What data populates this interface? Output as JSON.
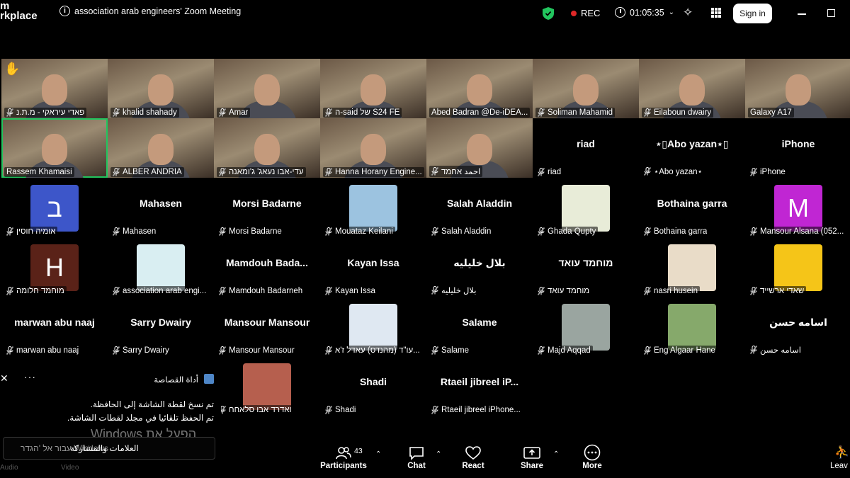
{
  "app": {
    "brand": "m\nrkplace",
    "meeting_title": "association arab engineers' Zoom Meeting",
    "rec_label": "REC",
    "timer": "01:05:35",
    "signin_label": "Sign in"
  },
  "colors": {
    "active_border": "#22c55e",
    "muted_mic": "#e02828",
    "rec_dot": "#e02828"
  },
  "tiles": [
    {
      "id": "t1",
      "name": "פאדי עיראקי - מ.ת.נ",
      "muted": true,
      "kind": "video",
      "hand": true
    },
    {
      "id": "t2",
      "name": "khalid shahady",
      "muted": true,
      "kind": "video"
    },
    {
      "id": "t3",
      "name": "Amar",
      "muted": true,
      "kind": "video"
    },
    {
      "id": "t4",
      "name": "ה-said של S24 FE",
      "muted": true,
      "kind": "video"
    },
    {
      "id": "t5",
      "name": "Abed Badran  @De-iDEA...",
      "muted": false,
      "kind": "video"
    },
    {
      "id": "t6",
      "name": "Soliman Mahamid",
      "muted": true,
      "kind": "video"
    },
    {
      "id": "t7",
      "name": "Eilaboun dwairy",
      "muted": true,
      "kind": "video"
    },
    {
      "id": "t8",
      "name": "Galaxy A17",
      "muted": false,
      "kind": "video"
    },
    {
      "id": "t9",
      "name": "Rassem Khamaisi",
      "muted": false,
      "kind": "video",
      "active": true
    },
    {
      "id": "t10",
      "name": "ALBER ANDRIA",
      "muted": true,
      "kind": "video"
    },
    {
      "id": "t11",
      "name": "עדי-אבו נעאג' ג'ומאנה",
      "muted": true,
      "kind": "video"
    },
    {
      "id": "t12",
      "name": "Hanna Horany Engine...",
      "muted": true,
      "kind": "video"
    },
    {
      "id": "t13",
      "name": "احمد אחמד",
      "muted": true,
      "kind": "video"
    },
    {
      "id": "t14",
      "name": "riad",
      "display": "riad",
      "muted": true,
      "kind": "name"
    },
    {
      "id": "t15",
      "name": "⋆Abo yazan⋆",
      "display": "⋆▯Abo yazan⋆▯",
      "muted": true,
      "kind": "name"
    },
    {
      "id": "t16",
      "name": "iPhone",
      "display": "iPhone",
      "muted": true,
      "kind": "name"
    },
    {
      "id": "t17",
      "name": "אומיה חוסין",
      "muted": true,
      "kind": "letter",
      "letter": "ב",
      "color": "#3d56c9"
    },
    {
      "id": "t18",
      "name": "Mahasen",
      "display": "Mahasen",
      "muted": true,
      "kind": "name"
    },
    {
      "id": "t19",
      "name": "Morsi Badarne",
      "display": "Morsi Badarne",
      "muted": true,
      "kind": "name"
    },
    {
      "id": "t20",
      "name": "Mouataz Keilani",
      "muted": true,
      "kind": "image",
      "color": "#9cc3e0"
    },
    {
      "id": "t21",
      "name": "Salah Aladdin",
      "display": "Salah Aladdin",
      "muted": true,
      "kind": "name"
    },
    {
      "id": "t22",
      "name": "Ghada Qupty",
      "muted": true,
      "kind": "image",
      "color": "#e8ecd8"
    },
    {
      "id": "t23",
      "name": "Bothaina garra",
      "display": "Bothaina garra",
      "muted": true,
      "kind": "name"
    },
    {
      "id": "t24",
      "name": "Mansour Alsana (052...",
      "muted": true,
      "kind": "letter",
      "letter": "M",
      "color": "#c026d3"
    },
    {
      "id": "t25",
      "name": "מוחמד חלומה",
      "muted": true,
      "kind": "letter",
      "letter": "H",
      "color": "#5a2218"
    },
    {
      "id": "t26",
      "name": "association arab engi...",
      "muted": true,
      "kind": "image",
      "color": "#d9eef2"
    },
    {
      "id": "t27",
      "name": "Mamdouh Badarneh",
      "display": "Mamdouh  Bada...",
      "muted": true,
      "kind": "name"
    },
    {
      "id": "t28",
      "name": "Kayan Issa",
      "display": "Kayan Issa",
      "muted": true,
      "kind": "name"
    },
    {
      "id": "t29",
      "name": "بلال خليليه",
      "display": "بلال خليليه",
      "muted": true,
      "kind": "name"
    },
    {
      "id": "t30",
      "name": "מוחמד עואד",
      "display": "מוחמד עואד",
      "muted": true,
      "kind": "name"
    },
    {
      "id": "t31",
      "name": "nasri husein",
      "muted": true,
      "kind": "image",
      "color": "#e9dcc8"
    },
    {
      "id": "t32",
      "name": "שאדי ארשייד",
      "muted": true,
      "kind": "image",
      "color": "#f5c518"
    },
    {
      "id": "t33",
      "name": "marwan abu naaj",
      "display": "marwan abu naaj",
      "muted": true,
      "kind": "name"
    },
    {
      "id": "t34",
      "name": "Sarry Dwairy",
      "display": "Sarry Dwairy",
      "muted": true,
      "kind": "name"
    },
    {
      "id": "t35",
      "name": "Mansour Mansour",
      "display": "Mansour Mansour",
      "muted": true,
      "kind": "name"
    },
    {
      "id": "t36",
      "name": "עו\"ד (מהנדס) עאדל ז'א...",
      "muted": true,
      "kind": "image",
      "color": "#dfe8f2"
    },
    {
      "id": "t37",
      "name": "Salame",
      "display": "Salame",
      "muted": true,
      "kind": "name"
    },
    {
      "id": "t38",
      "name": "Majd Aqqad",
      "muted": true,
      "kind": "image",
      "color": "#9aa5a0"
    },
    {
      "id": "t39",
      "name": "Eng Algaar Hane",
      "muted": true,
      "kind": "image",
      "color": "#86a96b"
    },
    {
      "id": "t40",
      "name": "اسامه حسن",
      "display": "اسامه حسن",
      "muted": true,
      "kind": "name"
    },
    {
      "id": "t41",
      "name": "ואדרד אבו סלאחח",
      "muted": true,
      "kind": "image",
      "color": "#b65f4e"
    },
    {
      "id": "t42",
      "name": "Shadi",
      "display": "Shadi",
      "muted": true,
      "kind": "name"
    },
    {
      "id": "t43",
      "name": "Rtaeil jibreel iPhone...",
      "display": "Rtaeil  jibreel  iP...",
      "muted": true,
      "kind": "name"
    }
  ],
  "notification": {
    "app_name": "أداة القصاصة",
    "line1": "تم نسخ لقطة الشاشة إلى الحافظة.",
    "line2": "تم الحفظ تلقائيا في مجلد لقطات الشاشة.",
    "watermark": "הפעל את Windows",
    "field_placeholder": "עבור אל 'הגדר Windows",
    "field_value": "العلامات والمشاركة"
  },
  "toolbar": {
    "participants_label": "Participants",
    "participants_count": "43",
    "chat_label": "Chat",
    "react_label": "React",
    "share_label": "Share",
    "more_label": "More",
    "leave_label": "Leav",
    "audio_label": "Audio",
    "video_label": "Video"
  }
}
